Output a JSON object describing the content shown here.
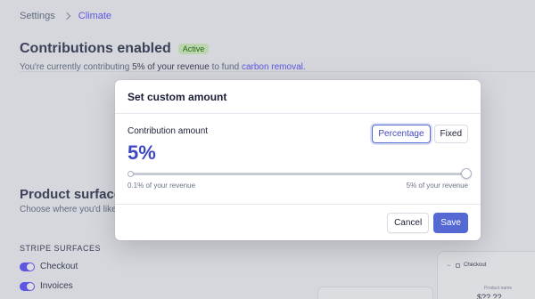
{
  "breadcrumb": {
    "root": "Settings",
    "current": "Climate"
  },
  "contributions": {
    "title": "Contributions enabled",
    "badge": "Active",
    "sub_prefix": "You're currently contributing",
    "sub_percent": "5% of your revenue",
    "sub_mid": "to fund",
    "sub_link": "carbon removal."
  },
  "product_surfaces": {
    "title": "Product surfaces",
    "subtitle": "Choose where you'd like",
    "section_label": "STRIPE SURFACES",
    "toggles": [
      {
        "label": "Checkout",
        "on": true
      },
      {
        "label": "Invoices",
        "on": true
      }
    ]
  },
  "preview": {
    "header": "Checkout",
    "name_label": "Product name",
    "price": "$??.??"
  },
  "modal": {
    "title": "Set custom amount",
    "field_label": "Contribution amount",
    "mode_options": [
      "Percentage",
      "Fixed"
    ],
    "selected_mode": "Percentage",
    "value_display": "5%",
    "slider": {
      "min_label": "0.1% of your revenue",
      "max_label": "5% of your revenue",
      "fraction": 1.0
    },
    "cancel_label": "Cancel",
    "save_label": "Save"
  },
  "colors": {
    "accent": "#5469d4",
    "accent_text": "#3f46c1",
    "badge_bg": "#d7f7c2"
  }
}
